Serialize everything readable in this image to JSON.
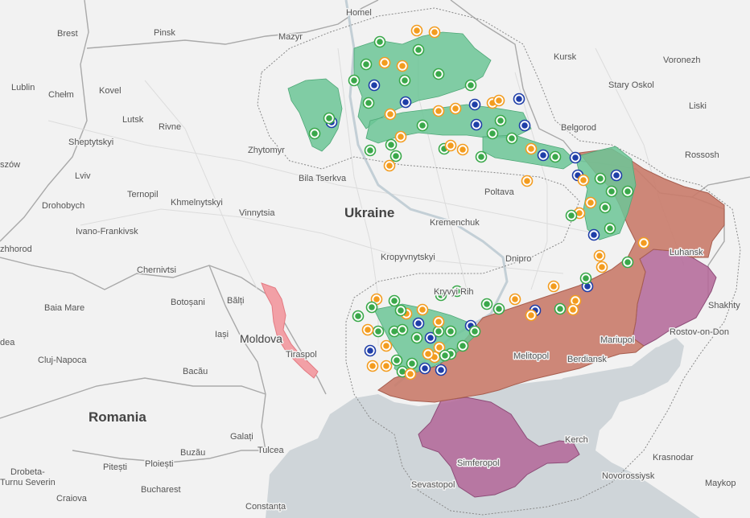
{
  "colors": {
    "land": "#f2f2f2",
    "sea": "#cfd5d9",
    "border": "#a9a9a9",
    "russian_controlled": "#c97b6a",
    "pre_war_occupied": "#b46a9a",
    "liberated": "#6cc596",
    "transnistria": "#f2a0a6",
    "dot_green": "#3aa84a",
    "dot_orange": "#f39c1f",
    "dot_blue": "#1f3ea8",
    "dot_olive": "#8a8a1f"
  },
  "labels": {
    "ukraine": "Ukraine",
    "romania": "Romania",
    "moldova": "Moldova",
    "cities": [
      {
        "key": "homel",
        "text": "Homel"
      },
      {
        "key": "brest",
        "text": "Brest"
      },
      {
        "key": "pinsk",
        "text": "Pinsk"
      },
      {
        "key": "mazyr",
        "text": "Mazyr"
      },
      {
        "key": "kursk",
        "text": "Kursk"
      },
      {
        "key": "voronezh",
        "text": "Voronezh"
      },
      {
        "key": "lublin",
        "text": "Lublin"
      },
      {
        "key": "chelm",
        "text": "Chełm"
      },
      {
        "key": "kovel",
        "text": "Kovel"
      },
      {
        "key": "stary_oskol",
        "text": "Stary Oskol"
      },
      {
        "key": "lutsk",
        "text": "Lutsk"
      },
      {
        "key": "rivne",
        "text": "Rivne"
      },
      {
        "key": "liski",
        "text": "Liski"
      },
      {
        "key": "sheptytskyi",
        "text": "Sheptytskyi"
      },
      {
        "key": "belgorod",
        "text": "Belgorod"
      },
      {
        "key": "zhytomyr",
        "text": "Zhytomyr"
      },
      {
        "key": "rossosh",
        "text": "Rossosh"
      },
      {
        "key": "rzeszow",
        "text": "szów"
      },
      {
        "key": "lviv",
        "text": "Lviv"
      },
      {
        "key": "bila_tserkva",
        "text": "Bila Tserkva"
      },
      {
        "key": "ternopil",
        "text": "Ternopil"
      },
      {
        "key": "poltava",
        "text": "Poltava"
      },
      {
        "key": "khmelnytskyi",
        "text": "Khmelnytskyi"
      },
      {
        "key": "drohobych",
        "text": "Drohobych"
      },
      {
        "key": "vinnytsia",
        "text": "Vinnytsia"
      },
      {
        "key": "kremenchuk",
        "text": "Kremenchuk"
      },
      {
        "key": "ivano_frankivsk",
        "text": "Ivano-Frankivsk"
      },
      {
        "key": "luhansk",
        "text": "Luhansk"
      },
      {
        "key": "uzhhorod",
        "text": "zhhorod"
      },
      {
        "key": "kropyvnytskyi",
        "text": "Kropyvnytskyi"
      },
      {
        "key": "dnipro",
        "text": "Dnipro"
      },
      {
        "key": "chernivtsi",
        "text": "Chernivtsi"
      },
      {
        "key": "kryvyi_rih",
        "text": "Kryvyi Rih"
      },
      {
        "key": "shakhty",
        "text": "Shakhty"
      },
      {
        "key": "botosani",
        "text": "Botoșani"
      },
      {
        "key": "balti",
        "text": "Bălți"
      },
      {
        "key": "baia_mare",
        "text": "Baia Mare"
      },
      {
        "key": "mariupol",
        "text": "Mariupol"
      },
      {
        "key": "rostov",
        "text": "Rostov-on-Don"
      },
      {
        "key": "iasi",
        "text": "Iași"
      },
      {
        "key": "oradea",
        "text": "dea"
      },
      {
        "key": "tiraspol",
        "text": "Tiraspol"
      },
      {
        "key": "cluj",
        "text": "Cluj-Napoca"
      },
      {
        "key": "melitopol",
        "text": "Melitopol"
      },
      {
        "key": "bacau",
        "text": "Bacău"
      },
      {
        "key": "berdiansk",
        "text": "Berdiansk"
      },
      {
        "key": "galati",
        "text": "Galați"
      },
      {
        "key": "tulcea",
        "text": "Tulcea"
      },
      {
        "key": "kerch",
        "text": "Kerch"
      },
      {
        "key": "krasnodar",
        "text": "Krasnodar"
      },
      {
        "key": "simferopol",
        "text": "Simferopol"
      },
      {
        "key": "buzau",
        "text": "Buzău"
      },
      {
        "key": "pitesti",
        "text": "Pitești"
      },
      {
        "key": "ploiesti",
        "text": "Ploiești"
      },
      {
        "key": "drobeta",
        "text": "Drobeta-"
      },
      {
        "key": "turnu",
        "text": "Turnu Severin"
      },
      {
        "key": "novorossiysk",
        "text": "Novorossiysk"
      },
      {
        "key": "sevastopol",
        "text": "Sevastopol"
      },
      {
        "key": "maykop",
        "text": "Maykop"
      },
      {
        "key": "craiova",
        "text": "Craiova"
      },
      {
        "key": "bucharest",
        "text": "Bucharest"
      },
      {
        "key": "constanta",
        "text": "Constanța"
      }
    ]
  }
}
